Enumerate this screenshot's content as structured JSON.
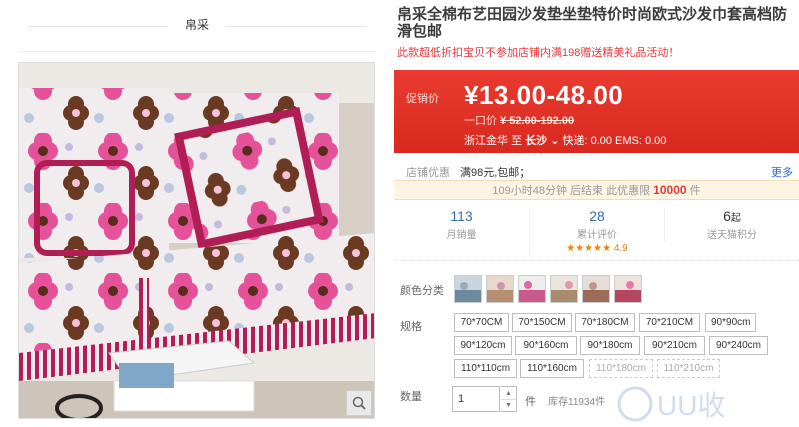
{
  "left": {
    "brand": "帛采",
    "zoom_icon": "magnifier-icon"
  },
  "product": {
    "title": "帛采全棉布艺田园沙发垫坐垫特价时尚欧式沙发巾套高档防滑包邮",
    "subtitle": "此款超低折扣宝贝不参加店铺内满198赠送精美礼品活动！"
  },
  "price": {
    "label": "促销价",
    "value": "¥13.00-48.00",
    "original_label": "一口价",
    "original_value": "¥ 52.00-192.00",
    "ship_from": "浙江金华",
    "ship_to_label": "至",
    "ship_to": "长沙",
    "shipping": "快递: 0.00 EMS: 0.00"
  },
  "promo": {
    "label": "店铺优惠",
    "text": "满98元,包邮；",
    "more": "更多"
  },
  "timer": {
    "prefix": "109小时48分钟 后结束",
    "middle": "此优惠限",
    "count": "10000",
    "suffix": "件"
  },
  "stats": {
    "monthly_sales": "113",
    "monthly_sales_label": "月销量",
    "reviews": "28",
    "reviews_label": "累计评价",
    "rating_stars": 5,
    "rating_value": "4.9",
    "points": "6",
    "points_unit": "起",
    "points_label": "送天猫积分"
  },
  "colors": {
    "label": "颜色分类",
    "accent": "#e4393c",
    "swatch_count": 6
  },
  "sizes": {
    "label": "规格",
    "options": [
      "70*70CM",
      "70*150CM",
      "70*180CM",
      "70*210CM",
      "90*90cm",
      "90*120cm",
      "90*160cm",
      "90*180cm",
      "90*210cm",
      "90*240cm",
      "110*110cm",
      "110*160cm",
      "110*180cm",
      "110*210cm"
    ]
  },
  "quantity": {
    "label": "数量",
    "value": "1",
    "unit": "件",
    "stock": "库存11934件"
  },
  "watermark": {
    "text": "UU收"
  }
}
